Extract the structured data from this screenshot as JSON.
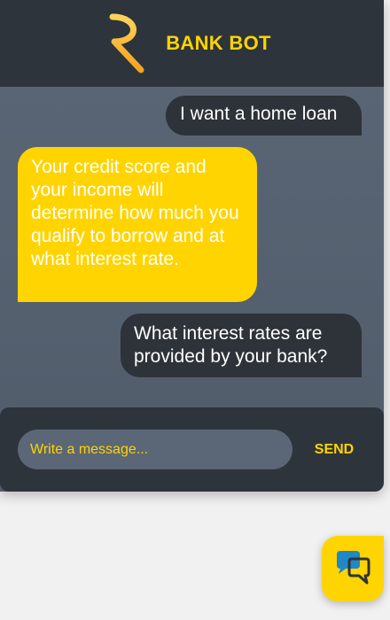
{
  "header": {
    "title": "BANK BOT",
    "icon": "rupee-icon"
  },
  "messages": [
    {
      "sender": "user",
      "text": "I want a home loan"
    },
    {
      "sender": "bot",
      "text": "Your credit score and your income will determine how much you qualify to borrow and at what interest rate."
    },
    {
      "sender": "user",
      "text": "What interest rates are provided by your bank?"
    }
  ],
  "composer": {
    "placeholder": "Write a message...",
    "value": "",
    "send_label": "SEND"
  },
  "launcher": {
    "icon": "chat-bubbles-icon"
  },
  "colors": {
    "accent": "#ffd400",
    "header_bg": "#2e343b",
    "chat_bg": "#5b6776",
    "user_bubble": "#2d3338",
    "page_bg": "#f1f1f1"
  }
}
